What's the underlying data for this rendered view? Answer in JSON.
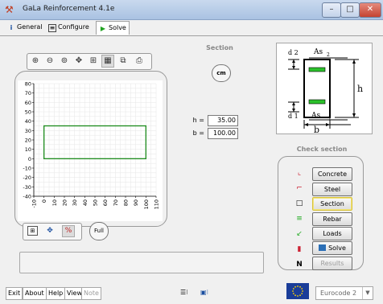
{
  "window": {
    "title": "GaLa Reinforcement  4.1e",
    "controls": [
      "minimize",
      "maximize",
      "close"
    ]
  },
  "tabs": [
    {
      "label": "General",
      "icon": "info-icon"
    },
    {
      "label": "Configure",
      "icon": "configure-icon"
    },
    {
      "label": "Solve",
      "icon": "play-icon",
      "active": true
    }
  ],
  "toolbar": {
    "icons": [
      "zoom-in-icon",
      "zoom-out-icon",
      "zoom-window-icon",
      "pan-icon",
      "grid-icon",
      "grid-fine-icon",
      "copy-icon",
      "print-icon"
    ],
    "selected": "grid-fine-icon"
  },
  "plot": {
    "y_ticks": [
      "80",
      "70",
      "60",
      "50",
      "40",
      "30",
      "20",
      "10",
      "0",
      "-10",
      "-20",
      "-30",
      "-40"
    ],
    "x_ticks": [
      "-10",
      "0",
      "10",
      "20",
      "30",
      "40",
      "50",
      "60",
      "70",
      "80",
      "90",
      "100",
      "110"
    ],
    "x_range": [
      -10,
      110
    ],
    "y_range": [
      -40,
      80
    ],
    "grid": true,
    "rect": {
      "x0": 0,
      "x1": 100,
      "y0": 0,
      "y1": 35,
      "color": "#1c8a1c"
    }
  },
  "bottom_tools": {
    "icons": [
      "calculator-icon",
      "move-icon",
      "percent-icon"
    ],
    "selected": "percent-icon",
    "full_label": "Full"
  },
  "section": {
    "title": "Section",
    "unit_label": "cm",
    "h_label": "h =",
    "h_value": "35.00",
    "b_label": "b =",
    "b_value": "100.00"
  },
  "diagram": {
    "d2": "d 2",
    "d1": "d 1",
    "as_top": "As",
    "sub2": "2",
    "as_bottom": "As",
    "sub1": "1",
    "h": "h",
    "b": "b"
  },
  "check": {
    "title": "Check section",
    "icons": [
      "concrete-law-icon",
      "steel-law-icon",
      "section-icon",
      "rebar-icon",
      "loads-icon",
      "solve-icon",
      "n-icon"
    ],
    "buttons": [
      {
        "label": "Concrete"
      },
      {
        "label": "Steel"
      },
      {
        "label": "Section",
        "focused": true
      },
      {
        "label": "Rebar"
      },
      {
        "label": "Loads"
      },
      {
        "label": "Solve",
        "icon": "solve-icon"
      },
      {
        "label": "Results",
        "disabled": true
      }
    ]
  },
  "footer": {
    "buttons": [
      {
        "label": "Exit"
      },
      {
        "label": "About"
      },
      {
        "label": "Help"
      },
      {
        "label": "View"
      },
      {
        "label": "Note",
        "disabled": true
      }
    ],
    "tool1": "layout-icon",
    "tool2": "monitor-icon",
    "code_select": "Eurocode 2",
    "flag": "eu-flag-icon"
  },
  "colors": {
    "accent_green": "#1c8a1c",
    "title_gradient": "#a9c2e2"
  }
}
